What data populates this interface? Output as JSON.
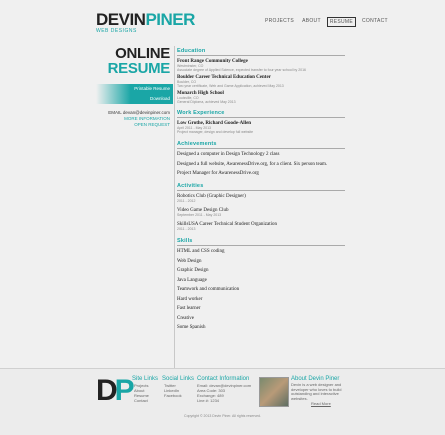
{
  "logo": {
    "first": "DEVIN",
    "last": "PINER",
    "sub": "WEB DESIGNS"
  },
  "nav": [
    {
      "label": "PROJECTS",
      "active": false
    },
    {
      "label": "ABOUT",
      "active": false
    },
    {
      "label": "RESUME",
      "active": true
    },
    {
      "label": "CONTACT",
      "active": false
    }
  ],
  "side": {
    "title1": "ONLINE",
    "title2": "RESUME",
    "printable": "Printable Resume",
    "download": "Download",
    "email_label": "EMAIL",
    "email_value": "devan@devinpiner.com",
    "more_info": "MORE INFORMATION",
    "open_request": "OPEN REQUEST"
  },
  "education": {
    "heading": "Education",
    "items": [
      {
        "name": "Front Range Community College",
        "sub1": "Westminster, CO",
        "sub2": "Associate degree of Applied Science, expected transfer to four year school by 2016"
      },
      {
        "name": "Boulder Career Technical Education Center",
        "sub1": "Boulder, CO",
        "sub2": "Two year certificate, Web and Game Application, achieved May 2013"
      },
      {
        "name": "Monarch High School",
        "sub1": "Louisville, CO",
        "sub2": "General Diploma, achieved May 2013"
      }
    ]
  },
  "experience": {
    "heading": "Work Experience",
    "items": [
      {
        "name": "Low Grothe, Richard Goode-Allen",
        "sub1": "April 2011 - May 2013",
        "sub2": "Project manager, design and develop full website"
      }
    ]
  },
  "achievements": {
    "heading": "Achievements",
    "items": [
      "Designed a computer in Design Technology 2 class",
      "Designed a full website, AwarenessDrive.org, for a client. Six person team.",
      "Project Manager for AwarenessDrive.org"
    ]
  },
  "activities": {
    "heading": "Activities",
    "items": [
      {
        "name": "Robotics Club (Graphic Designer)",
        "sub": "2011 - 2012"
      },
      {
        "name": "Video Game Design Club",
        "sub": "September 2011 - May 2013"
      },
      {
        "name": "SkillsUSA Career Technical Student Organization",
        "sub": "2011 - 2013"
      }
    ]
  },
  "skills": {
    "heading": "Skills",
    "items": [
      "HTML and CSS coding",
      "Web Design",
      "Graphic Design",
      "Java Language",
      "Teamwork and communication",
      "Hard worker",
      "Fast learner",
      "Creative",
      "Some Spanish"
    ]
  },
  "footer": {
    "d": "D",
    "p": "P",
    "site_links": {
      "heading": "Site Links",
      "items": [
        "Projects",
        "About",
        "Resume",
        "Contact"
      ]
    },
    "social_links": {
      "heading": "Social Links",
      "items": [
        "Twitter",
        "LinkedIn",
        "Facebook"
      ]
    },
    "contact_info": {
      "heading": "Contact Information",
      "items": [
        "Email: devan@devinpiner.com",
        "Area Code: 303",
        "Exchange: 489",
        "Line #: 1234"
      ]
    },
    "about": {
      "heading": "About Devin Piner",
      "text": "Devin is a web designer and developer who loves to build outstanding and interactive websites.",
      "more": "Read More"
    },
    "copyright": "Copyright © 2013 Devin Piner. All rights reserved."
  },
  "colors": {
    "accent": "#1aa6a6",
    "dark": "#222222"
  }
}
